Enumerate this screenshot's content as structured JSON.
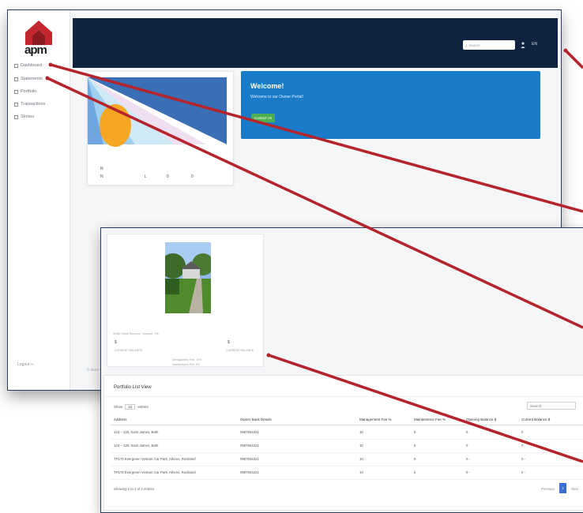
{
  "brand": {
    "logo_text": "apm",
    "logo_color": "#c4262e"
  },
  "sidebar": {
    "items": [
      {
        "label": "Dashboard",
        "icon": "chart-icon"
      },
      {
        "label": "Statements",
        "icon": "document-icon"
      },
      {
        "label": "Portfolio",
        "icon": "home-icon"
      },
      {
        "label": "Transactions",
        "icon": "dollar-icon"
      },
      {
        "label": "Stories",
        "icon": "list-icon"
      }
    ],
    "logout": "Logout ⇨"
  },
  "header": {
    "search_placeholder": "Search",
    "language": "EN",
    "background": "#0f2341"
  },
  "profile_card": {
    "stat_n1": "N",
    "stat_n2": "N",
    "stat_l": "L",
    "stat_0": "0",
    "stat_s": "0"
  },
  "welcome": {
    "title": "Welcome!",
    "subtitle": "Welcome to our Owner Portal!",
    "button": "Contact Us",
    "background": "#1a7bc9",
    "button_color": "#4caf50"
  },
  "footer": {
    "copyright": "© 2023 –"
  },
  "property": {
    "caption": "Smith Home Services · Ashford · PA",
    "value_left": "$",
    "value_right": "$",
    "label_left": "CURRENT BALANCE",
    "label_right": "CURRENT BALANCE",
    "mgmt_line": "Management Fee: 10%",
    "maint_line": "Maintenance Fee: 5%"
  },
  "portfolio": {
    "title": "Portfolio List View",
    "show_label": "Show",
    "entries_value": "10",
    "entries_label": "entries",
    "search_label": "Search:",
    "columns": [
      "Address",
      "Owner Bank Details",
      "Management Fee %",
      "Maintenance Fee %",
      "Opening Balance $",
      "Current Balance $"
    ],
    "rows": [
      [
        "123 – 125, Saint James, Bath",
        "0987654321",
        "10",
        "5",
        "0",
        "0"
      ],
      [
        "123 – 125, Saint James, Bath",
        "0987654321",
        "10",
        "5",
        "0",
        "0"
      ],
      [
        "TP176 Evergreen Venture Car Park, Athens, Rockland",
        "0987654321",
        "10",
        "5",
        "0 -",
        "0 -"
      ],
      [
        "TP176 Evergreen Venture Car Park, Athens, Rockland",
        "0987654321",
        "10",
        "5",
        "0 -",
        "0 -"
      ]
    ],
    "showing": "Showing 1 to 4 of 4 entries",
    "pager_prev": "Previous",
    "pager_page": "1",
    "pager_next": "Next"
  },
  "accent_color": "#b5232b"
}
